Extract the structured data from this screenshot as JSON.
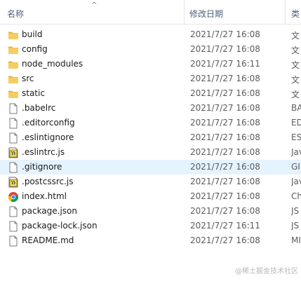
{
  "header": {
    "name_col": "名称",
    "date_col": "修改日期",
    "type_col": "类"
  },
  "rows": [
    {
      "name": "build",
      "date": "2021/7/27 16:08",
      "type": "文",
      "icon": "folder-icon"
    },
    {
      "name": "config",
      "date": "2021/7/27 16:08",
      "type": "文",
      "icon": "folder-icon"
    },
    {
      "name": "node_modules",
      "date": "2021/7/27 16:11",
      "type": "文",
      "icon": "folder-icon"
    },
    {
      "name": "src",
      "date": "2021/7/27 16:08",
      "type": "文",
      "icon": "folder-icon"
    },
    {
      "name": "static",
      "date": "2021/7/27 16:08",
      "type": "文",
      "icon": "folder-icon"
    },
    {
      "name": ".babelrc",
      "date": "2021/7/27 16:08",
      "type": "BA",
      "icon": "file-icon"
    },
    {
      "name": ".editorconfig",
      "date": "2021/7/27 16:08",
      "type": "ED",
      "icon": "file-icon"
    },
    {
      "name": ".eslintignore",
      "date": "2021/7/27 16:08",
      "type": "ES",
      "icon": "file-icon"
    },
    {
      "name": ".eslintrc.js",
      "date": "2021/7/27 16:08",
      "type": "Jav",
      "icon": "js-file-icon"
    },
    {
      "name": ".gitignore",
      "date": "2021/7/27 16:08",
      "type": "GI",
      "icon": "file-icon"
    },
    {
      "name": ".postcssrc.js",
      "date": "2021/7/27 16:08",
      "type": "Jav",
      "icon": "js-file-icon"
    },
    {
      "name": "index.html",
      "date": "2021/7/27 16:08",
      "type": "Ch",
      "icon": "chrome-icon"
    },
    {
      "name": "package.json",
      "date": "2021/7/27 16:08",
      "type": "JS",
      "icon": "file-icon"
    },
    {
      "name": "package-lock.json",
      "date": "2021/7/27 16:11",
      "type": "JS",
      "icon": "file-icon"
    },
    {
      "name": "README.md",
      "date": "2021/7/27 16:08",
      "type": "MI",
      "icon": "file-icon"
    }
  ],
  "selected_row": ".gitignore",
  "watermark": "@稀土掘金技术社区",
  "colors": {
    "folder": "#f7c85b",
    "selection": "#e5f3ff"
  }
}
